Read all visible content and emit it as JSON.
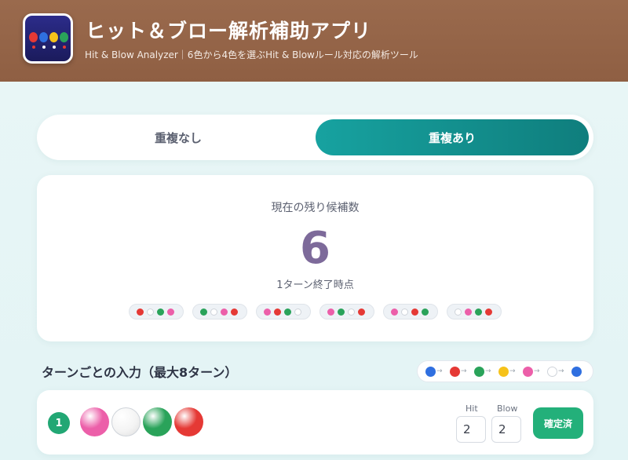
{
  "colors": {
    "red": "#e53935",
    "white": "#f5f5f5",
    "green": "#2aa35a",
    "pink": "#ec5fa9",
    "blue": "#2f6fe0",
    "yellow": "#f6c21a",
    "teal_accent": "#138f8d",
    "header_brown": "#966647",
    "count_purple": "#7d6a9a"
  },
  "header": {
    "app_icon": "colored-balls-icon",
    "title": "ヒット＆ブロー解析補助アプリ",
    "subtitle": "Hit & Blow Analyzer｜6色から4色を選ぶHit & Blowルール対応の解析ツール"
  },
  "mode_toggle": {
    "options": [
      "重複なし",
      "重複あり"
    ],
    "selected": "重複あり"
  },
  "summary": {
    "label": "現在の残り候補数",
    "count": "6",
    "sub": "1ターン終了時点",
    "candidates": [
      [
        "red",
        "white",
        "green",
        "pink"
      ],
      [
        "green",
        "white",
        "pink",
        "red"
      ],
      [
        "pink",
        "red",
        "green",
        "white"
      ],
      [
        "pink",
        "green",
        "white",
        "red"
      ],
      [
        "pink",
        "white",
        "red",
        "green"
      ],
      [
        "white",
        "pink",
        "green",
        "red"
      ]
    ]
  },
  "turns_section": {
    "title": "ターンごとの入力（最大8ターン）",
    "color_cycle": [
      "blue",
      "red",
      "green",
      "yellow",
      "pink",
      "white",
      "blue"
    ],
    "turns": [
      {
        "number": "1",
        "pegs": [
          "pink",
          "white",
          "green",
          "red"
        ],
        "hit_label": "Hit",
        "blow_label": "Blow",
        "hit": "2",
        "blow": "2",
        "button": "確定済"
      }
    ]
  }
}
